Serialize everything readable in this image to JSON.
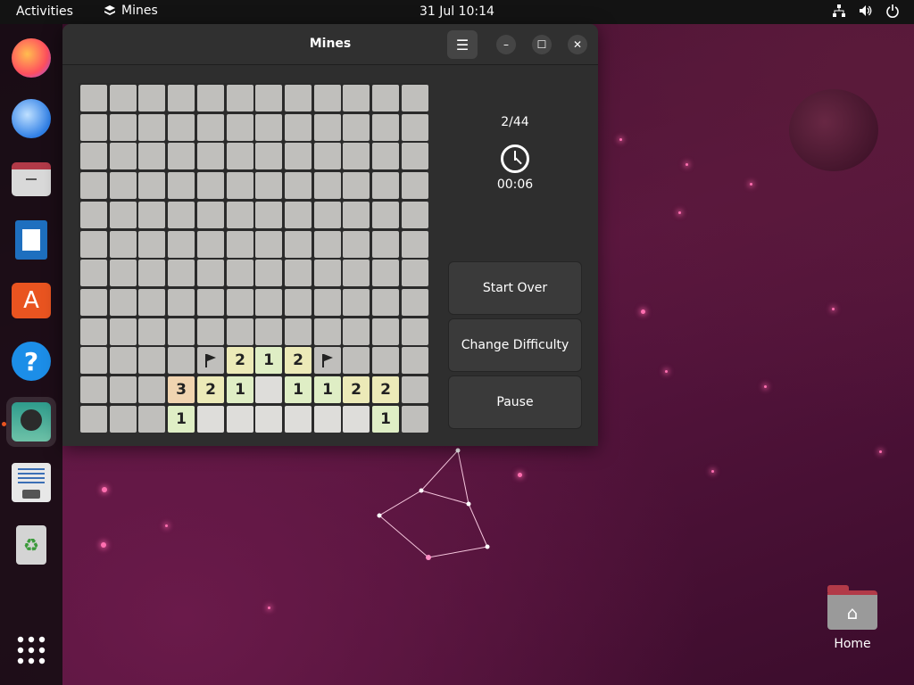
{
  "topbar": {
    "activities": "Activities",
    "app_name": "Mines",
    "clock": "31 Jul  10:14",
    "icons": [
      "network-icon",
      "volume-icon",
      "power-icon"
    ]
  },
  "dock": {
    "items": [
      {
        "name": "firefox",
        "icon": "firefox-icon"
      },
      {
        "name": "thunderbird",
        "icon": "thunderbird-icon"
      },
      {
        "name": "files",
        "icon": "files-icon"
      },
      {
        "name": "libreoffice-writer",
        "icon": "writer-icon"
      },
      {
        "name": "ubuntu-software",
        "icon": "software-icon"
      },
      {
        "name": "help",
        "icon": "help-icon"
      },
      {
        "name": "mines",
        "icon": "mines-icon",
        "active": true
      },
      {
        "name": "text-editor",
        "icon": "text-editor-icon"
      },
      {
        "name": "trash",
        "icon": "trash-icon"
      }
    ],
    "show_apps_icon": "grid-icon"
  },
  "window": {
    "title": "Mines",
    "menu_icon": "☰",
    "minimize_icon": "–",
    "maximize_icon": "☐",
    "close_icon": "✕"
  },
  "game": {
    "rows": 12,
    "cols": 12,
    "mine_counter": "2/44",
    "timer": "00:06",
    "revealed": [
      {
        "r": 9,
        "c": 4,
        "v": "F"
      },
      {
        "r": 9,
        "c": 5,
        "v": "2"
      },
      {
        "r": 9,
        "c": 6,
        "v": "1"
      },
      {
        "r": 9,
        "c": 7,
        "v": "2"
      },
      {
        "r": 9,
        "c": 8,
        "v": "F"
      },
      {
        "r": 10,
        "c": 3,
        "v": "3"
      },
      {
        "r": 10,
        "c": 4,
        "v": "2"
      },
      {
        "r": 10,
        "c": 5,
        "v": "1"
      },
      {
        "r": 10,
        "c": 6,
        "v": ""
      },
      {
        "r": 10,
        "c": 7,
        "v": "1"
      },
      {
        "r": 10,
        "c": 8,
        "v": "1"
      },
      {
        "r": 10,
        "c": 9,
        "v": "2"
      },
      {
        "r": 10,
        "c": 10,
        "v": "2"
      },
      {
        "r": 11,
        "c": 3,
        "v": "1"
      },
      {
        "r": 11,
        "c": 4,
        "v": ""
      },
      {
        "r": 11,
        "c": 5,
        "v": ""
      },
      {
        "r": 11,
        "c": 6,
        "v": ""
      },
      {
        "r": 11,
        "c": 7,
        "v": ""
      },
      {
        "r": 11,
        "c": 8,
        "v": ""
      },
      {
        "r": 11,
        "c": 9,
        "v": ""
      },
      {
        "r": 11,
        "c": 10,
        "v": "1"
      }
    ],
    "number_colors": {
      "1": "#dfeec5",
      "2": "#eceab8",
      "3": "#f0d4b0"
    }
  },
  "buttons": {
    "start_over": "Start Over",
    "change_difficulty": "Change Difficulty",
    "pause": "Pause"
  },
  "desktop": {
    "home_label": "Home"
  }
}
